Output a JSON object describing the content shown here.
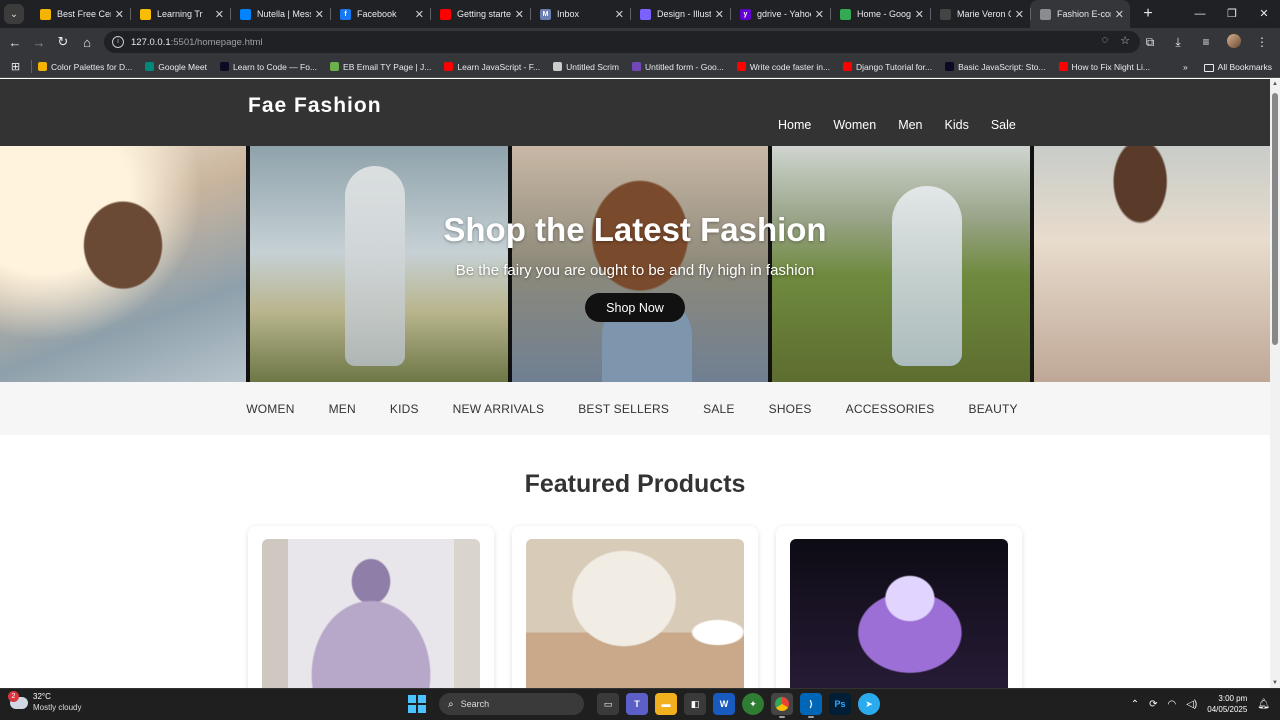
{
  "browser": {
    "tabs": [
      {
        "title": "Best Free Certi",
        "fav_color": "#f4b400",
        "fav_glyph": "",
        "active": false
      },
      {
        "title": "Learning Tr",
        "fav_color": "#fbbc04",
        "fav_glyph": "",
        "active": false
      },
      {
        "title": "Nutella | Messe",
        "fav_color": "#0084ff",
        "fav_glyph": "",
        "active": false
      },
      {
        "title": "Facebook",
        "fav_color": "#1877f2",
        "fav_glyph": "f",
        "active": false
      },
      {
        "title": "Getting started",
        "fav_color": "#ff0000",
        "fav_glyph": "",
        "active": false
      },
      {
        "title": "Inbox",
        "fav_color": "#6b7fb3",
        "fav_glyph": "M",
        "active": false
      },
      {
        "title": "Design - Illustr",
        "fav_color": "#7b61ff",
        "fav_glyph": "",
        "active": false
      },
      {
        "title": "gdrive - Yahoo",
        "fav_color": "#6001d2",
        "fav_glyph": "y",
        "active": false
      },
      {
        "title": "Home - Googl",
        "fav_color": "#34a853",
        "fav_glyph": "",
        "active": false
      },
      {
        "title": "Marie Veron C",
        "fav_color": "#444444",
        "fav_glyph": "",
        "active": false
      },
      {
        "title": "Fashion E-comm",
        "fav_color": "#8a8c8f",
        "fav_glyph": "",
        "active": true
      }
    ],
    "new_tab_glyph": "+",
    "url_host": "127.0.0.1",
    "url_path": ":5501/homepage.html",
    "bookmarks": [
      {
        "label": "Color Palettes for D...",
        "color": "#f4b400"
      },
      {
        "label": "Google Meet",
        "color": "#00897b"
      },
      {
        "label": "Learn to Code — Fo...",
        "color": "#0a0a23"
      },
      {
        "label": "EB Email TY Page | J...",
        "color": "#6ab04c"
      },
      {
        "label": "Learn JavaScript - F...",
        "color": "#ff0000"
      },
      {
        "label": "Untitled Scrim",
        "color": "#cccccc"
      },
      {
        "label": "Untitled form - Goo...",
        "color": "#7248b9"
      },
      {
        "label": "Write code faster in...",
        "color": "#ff0000"
      },
      {
        "label": "Django Tutorial for...",
        "color": "#ff0000"
      },
      {
        "label": "Basic JavaScript: Sto...",
        "color": "#0a0a23"
      },
      {
        "label": "How to Fix Night Li...",
        "color": "#ff0000"
      }
    ],
    "all_bookmarks_label": "All Bookmarks"
  },
  "site": {
    "logo": "Fae Fashion",
    "nav": [
      "Home",
      "Women",
      "Men",
      "Kids",
      "Sale"
    ],
    "hero": {
      "title": "Shop the Latest Fashion",
      "subtitle": "Be the fairy you are ought to be and fly high in fashion",
      "cta": "Shop Now"
    },
    "categories": [
      "WOMEN",
      "MEN",
      "KIDS",
      "NEW ARRIVALS",
      "BEST SELLERS",
      "SALE",
      "SHOES",
      "ACCESSORIES",
      "BEAUTY"
    ],
    "featured_title": "Featured Products",
    "products": [
      {
        "image": "lavender tulle gown on mannequin",
        "colors": [
          "#e8e6ea",
          "#b7a7c9",
          "#8f7ea8"
        ]
      },
      {
        "image": "floral puff-sleeve blouse with flowers",
        "colors": [
          "#d8cbb8",
          "#f2ede4",
          "#c9a98a"
        ]
      },
      {
        "image": "purple crystal butterfly jewelry",
        "colors": [
          "#0d0b14",
          "#9c6fd6",
          "#e1d4ff"
        ]
      }
    ]
  },
  "taskbar": {
    "weather_temp": "32°C",
    "weather_desc": "Mostly cloudy",
    "weather_badge": "2",
    "search_label": "Search",
    "time": "3:00 pm",
    "date": "04/05/2025"
  }
}
